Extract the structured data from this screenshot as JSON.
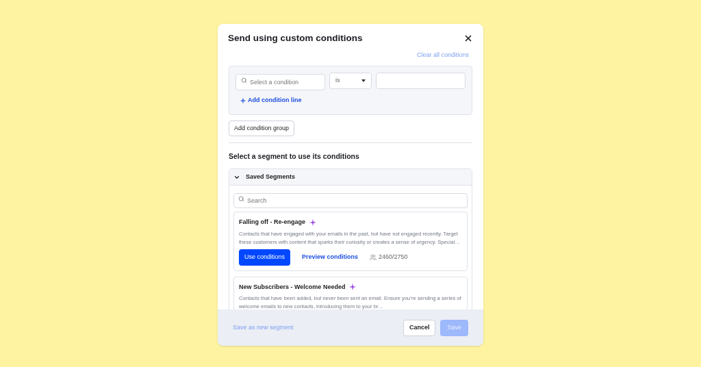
{
  "dialog": {
    "title": "Send using custom conditions",
    "clear_link": "Clear all conditions",
    "condition_group": {
      "condition_placeholder": "Select a condition",
      "operator": "is",
      "add_line": "Add condition line"
    },
    "add_group_button": "Add condition group",
    "segment_heading": "Select a segment to use its conditions",
    "saved_segments": {
      "title": "Saved Segments",
      "expanded": true,
      "search_placeholder": "Search",
      "items": [
        {
          "name": "Falling off - Re-engage",
          "description": "Contacts that have engaged with your emails in the past, but have not engaged recently. Target these customers with content that sparks their curiosity or creates a sense of urgency. Special…",
          "use_button": "Use conditions",
          "preview_link": "Preview conditions",
          "count": "2460/2750"
        },
        {
          "name": "New Subscribers - Welcome Needed",
          "description": "Contacts that have been added, but never been sent an email. Ensure you’re sending a series of welcome emails to new contacts, introducing them to your br…"
        }
      ]
    },
    "footer": {
      "save_segment_link": "Save as new segment",
      "cancel_button": "Cancel",
      "save_button": "Save",
      "save_disabled": true
    }
  }
}
